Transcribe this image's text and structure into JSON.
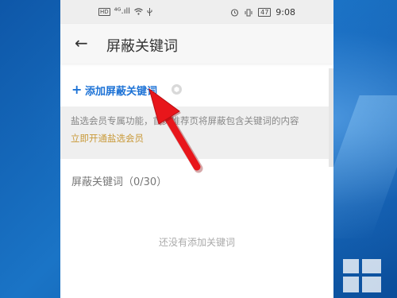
{
  "status_bar": {
    "hd_label": "HD",
    "signal_text": "⁴ᴳ.ıll",
    "battery_level": "47",
    "time": "9:08"
  },
  "header": {
    "title": "屏蔽关键词",
    "back_icon": "←"
  },
  "add_keyword": {
    "plus": "+",
    "label": "添加屏蔽关键词"
  },
  "notice": {
    "text": "盐选会员专属功能，首页推荐页将屏蔽包含关键词的内容",
    "link": "立即开通盐选会员"
  },
  "keywords_section": {
    "title": "屏蔽关键词（0/30）",
    "empty_text": "还没有添加关键词"
  },
  "colors": {
    "accent": "#1e73d6",
    "vip_gold": "#c99a3a",
    "arrow_red": "#e8161b"
  }
}
